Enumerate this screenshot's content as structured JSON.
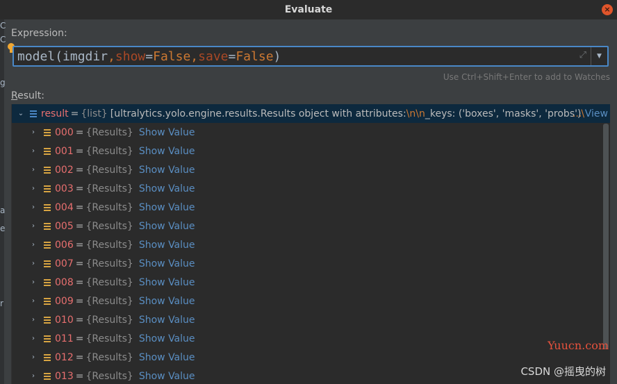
{
  "window": {
    "title": "Evaluate",
    "close_glyph": "×"
  },
  "left_strip": [
    "C",
    "C",
    "g",
    "a",
    "e",
    "r"
  ],
  "expression": {
    "label": "Expression:",
    "tokens": [
      {
        "t": "model",
        "k": "ident"
      },
      {
        "t": "(",
        "k": "ident"
      },
      {
        "t": "imgdir",
        "k": "ident"
      },
      {
        "t": ",",
        "k": "punct"
      },
      {
        "t": "show",
        "k": "kw"
      },
      {
        "t": "=",
        "k": "eq"
      },
      {
        "t": "False",
        "k": "const"
      },
      {
        "t": ",",
        "k": "punct"
      },
      {
        "t": "save",
        "k": "kw"
      },
      {
        "t": "=",
        "k": "eq"
      },
      {
        "t": "False",
        "k": "const"
      },
      {
        "t": ")",
        "k": "ident"
      }
    ],
    "hint": "Use Ctrl+Shift+Enter to add to Watches",
    "icons": {
      "bulb": "lightbulb-icon",
      "expand": "expand-icon",
      "dropdown": "chevron-down-icon"
    }
  },
  "result": {
    "label_prefix": "R",
    "label_rest": "esult:",
    "root": {
      "name": "result",
      "eq": "=",
      "type": "{list}",
      "value_pre": "[ultralytics.yolo.engine.results.Results object with attributes:",
      "value_esc1": "\\n\\n",
      "value_mid": "_keys: ('boxes', 'masks', 'probs')",
      "value_esc2": "\\",
      "view_ellipsis": "...",
      "view_label": "View"
    },
    "items": [
      {
        "name": "000",
        "type": "{Results}",
        "action": "Show Value"
      },
      {
        "name": "001",
        "type": "{Results}",
        "action": "Show Value"
      },
      {
        "name": "002",
        "type": "{Results}",
        "action": "Show Value"
      },
      {
        "name": "003",
        "type": "{Results}",
        "action": "Show Value"
      },
      {
        "name": "004",
        "type": "{Results}",
        "action": "Show Value"
      },
      {
        "name": "005",
        "type": "{Results}",
        "action": "Show Value"
      },
      {
        "name": "006",
        "type": "{Results}",
        "action": "Show Value"
      },
      {
        "name": "007",
        "type": "{Results}",
        "action": "Show Value"
      },
      {
        "name": "008",
        "type": "{Results}",
        "action": "Show Value"
      },
      {
        "name": "009",
        "type": "{Results}",
        "action": "Show Value"
      },
      {
        "name": "010",
        "type": "{Results}",
        "action": "Show Value"
      },
      {
        "name": "011",
        "type": "{Results}",
        "action": "Show Value"
      },
      {
        "name": "012",
        "type": "{Results}",
        "action": "Show Value"
      },
      {
        "name": "013",
        "type": "{Results}",
        "action": "Show Value"
      }
    ]
  },
  "watermarks": {
    "site": "Yuucn.com",
    "credit": "CSDN @摇曳的树"
  },
  "colors": {
    "accent": "#4a88c7",
    "link": "#5a8ec2",
    "var_name": "#e86f6f",
    "keyword": "#cc7832"
  }
}
